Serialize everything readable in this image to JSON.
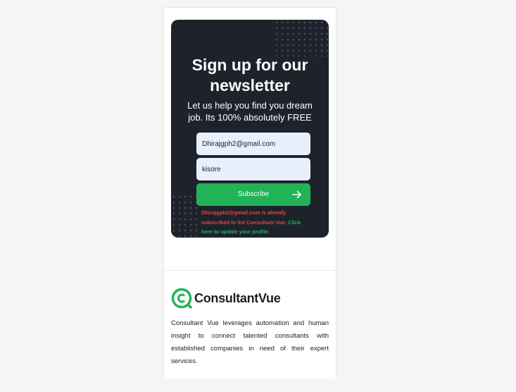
{
  "newsletter": {
    "title": "Sign up for our newsletter",
    "subtitle": "Let us help you find you dream job. Its 100% absolutely FREE",
    "email_value": "Dhirajgph2@gmail.com",
    "name_value": "kisore",
    "subscribe_label": "Subscribe",
    "error_text": "Dhirajgph2@gmail.com is already subscribed to list Consultant Vue.",
    "update_link_text": "Click here to update your profile"
  },
  "footer": {
    "brand_name": "ConsultantVue",
    "logo_icon": "consultantvue-logo-icon",
    "description": "Consultant Vue leverages automation and human insight to connect talented consultants with established companies in need of their expert services."
  },
  "colors": {
    "card_bg": "#1e232b",
    "accent_green": "#22b358",
    "error_red": "#e04444",
    "input_bg": "#e8f0fe"
  }
}
